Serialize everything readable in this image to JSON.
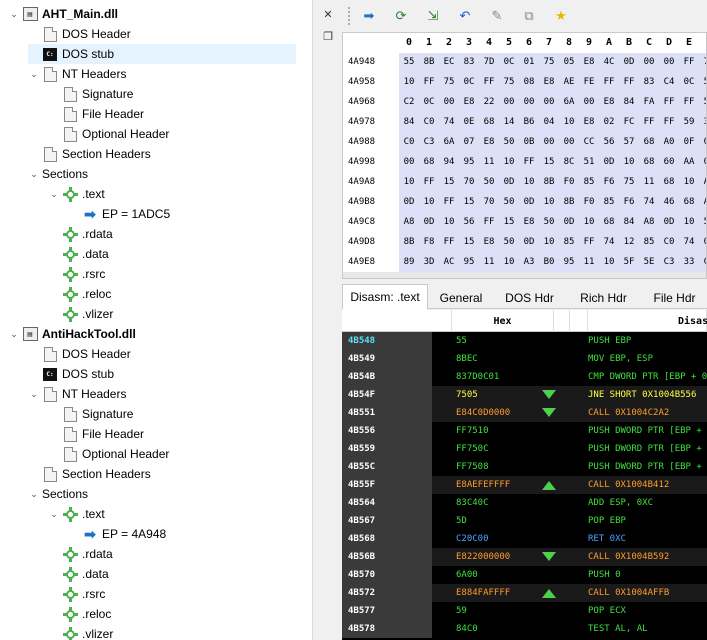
{
  "tree": [
    {
      "label": "AHT_Main.dll",
      "level": 0,
      "icon": "dll",
      "exp": "down",
      "bold": true
    },
    {
      "label": "DOS Header",
      "level": 1,
      "icon": "file"
    },
    {
      "label": "DOS stub",
      "level": 1,
      "icon": "dos",
      "selected": true
    },
    {
      "label": "NT Headers",
      "level": 1,
      "icon": "file",
      "exp": "down"
    },
    {
      "label": "Signature",
      "level": 2,
      "icon": "file"
    },
    {
      "label": "File Header",
      "level": 2,
      "icon": "file"
    },
    {
      "label": "Optional Header",
      "level": 2,
      "icon": "file"
    },
    {
      "label": "Section Headers",
      "level": 1,
      "icon": "file"
    },
    {
      "label": "Sections",
      "level": 1,
      "icon": "none",
      "exp": "down"
    },
    {
      "label": ".text",
      "level": 2,
      "icon": "gear",
      "exp": "down"
    },
    {
      "label": "EP = 1ADC5",
      "level": 3,
      "icon": "arrow"
    },
    {
      "label": ".rdata",
      "level": 2,
      "icon": "gear"
    },
    {
      "label": ".data",
      "level": 2,
      "icon": "gear"
    },
    {
      "label": ".rsrc",
      "level": 2,
      "icon": "gear"
    },
    {
      "label": ".reloc",
      "level": 2,
      "icon": "gear"
    },
    {
      "label": ".vlizer",
      "level": 2,
      "icon": "gear"
    },
    {
      "label": "AntiHackTool.dll",
      "level": 0,
      "icon": "dll",
      "exp": "down",
      "bold": true
    },
    {
      "label": "DOS Header",
      "level": 1,
      "icon": "file"
    },
    {
      "label": "DOS stub",
      "level": 1,
      "icon": "dos"
    },
    {
      "label": "NT Headers",
      "level": 1,
      "icon": "file",
      "exp": "down"
    },
    {
      "label": "Signature",
      "level": 2,
      "icon": "file"
    },
    {
      "label": "File Header",
      "level": 2,
      "icon": "file"
    },
    {
      "label": "Optional Header",
      "level": 2,
      "icon": "file"
    },
    {
      "label": "Section Headers",
      "level": 1,
      "icon": "file"
    },
    {
      "label": "Sections",
      "level": 1,
      "icon": "none",
      "exp": "down"
    },
    {
      "label": ".text",
      "level": 2,
      "icon": "gear",
      "exp": "down"
    },
    {
      "label": "EP = 4A948",
      "level": 3,
      "icon": "arrow"
    },
    {
      "label": ".rdata",
      "level": 2,
      "icon": "gear"
    },
    {
      "label": ".data",
      "level": 2,
      "icon": "gear"
    },
    {
      "label": ".rsrc",
      "level": 2,
      "icon": "gear"
    },
    {
      "label": ".reloc",
      "level": 2,
      "icon": "gear"
    },
    {
      "label": ".vlizer",
      "level": 2,
      "icon": "gear"
    }
  ],
  "splitter": {
    "close": "✕",
    "restore": "❐"
  },
  "toolbar": [
    {
      "name": "go-to-icon",
      "glyph": "➡",
      "color": "#1a73c8"
    },
    {
      "name": "refresh-icon",
      "glyph": "⟳",
      "color": "#2e7d32"
    },
    {
      "name": "import-icon",
      "glyph": "⇲",
      "color": "#2e7d32"
    },
    {
      "name": "undo-icon",
      "glyph": "↶",
      "color": "#1a56c8"
    },
    {
      "name": "pin-icon",
      "glyph": "✎",
      "color": "#888888"
    },
    {
      "name": "copy-icon",
      "glyph": "⧉",
      "color": "#888888"
    },
    {
      "name": "favorite-icon",
      "glyph": "★",
      "color": "#e6b800"
    }
  ],
  "hex": {
    "columns": [
      "0",
      "1",
      "2",
      "3",
      "4",
      "5",
      "6",
      "7",
      "8",
      "9",
      "A",
      "B",
      "C",
      "D",
      "E",
      "F"
    ],
    "rows": [
      {
        "addr": "4A948",
        "bytes": [
          "55",
          "8B",
          "EC",
          "83",
          "7D",
          "0C",
          "01",
          "75",
          "05",
          "E8",
          "4C",
          "0D",
          "00",
          "00",
          "FF",
          "75"
        ]
      },
      {
        "addr": "4A958",
        "bytes": [
          "10",
          "FF",
          "75",
          "0C",
          "FF",
          "75",
          "08",
          "E8",
          "AE",
          "FE",
          "FF",
          "FF",
          "83",
          "C4",
          "0C",
          "5D"
        ]
      },
      {
        "addr": "4A968",
        "bytes": [
          "C2",
          "0C",
          "00",
          "E8",
          "22",
          "00",
          "00",
          "00",
          "6A",
          "00",
          "E8",
          "84",
          "FA",
          "FF",
          "FF",
          "59"
        ]
      },
      {
        "addr": "4A978",
        "bytes": [
          "84",
          "C0",
          "74",
          "0E",
          "68",
          "14",
          "B6",
          "04",
          "10",
          "E8",
          "02",
          "FC",
          "FF",
          "FF",
          "59",
          "33"
        ]
      },
      {
        "addr": "4A988",
        "bytes": [
          "C0",
          "C3",
          "6A",
          "07",
          "E8",
          "50",
          "0B",
          "00",
          "00",
          "CC",
          "56",
          "57",
          "68",
          "A0",
          "0F",
          "00"
        ]
      },
      {
        "addr": "4A998",
        "bytes": [
          "00",
          "68",
          "94",
          "95",
          "11",
          "10",
          "FF",
          "15",
          "8C",
          "51",
          "0D",
          "10",
          "68",
          "60",
          "AA",
          "0D"
        ]
      },
      {
        "addr": "4A9A8",
        "bytes": [
          "10",
          "FF",
          "15",
          "70",
          "50",
          "0D",
          "10",
          "8B",
          "F0",
          "85",
          "F6",
          "75",
          "11",
          "68",
          "10",
          "AA"
        ]
      },
      {
        "addr": "4A9B8",
        "bytes": [
          "0D",
          "10",
          "FF",
          "15",
          "70",
          "50",
          "0D",
          "10",
          "8B",
          "F0",
          "85",
          "F6",
          "74",
          "46",
          "68",
          "A0"
        ]
      },
      {
        "addr": "4A9C8",
        "bytes": [
          "A8",
          "0D",
          "10",
          "56",
          "FF",
          "15",
          "E8",
          "50",
          "0D",
          "10",
          "68",
          "84",
          "A8",
          "0D",
          "10",
          "56"
        ]
      },
      {
        "addr": "4A9D8",
        "bytes": [
          "8B",
          "F8",
          "FF",
          "15",
          "E8",
          "50",
          "0D",
          "10",
          "85",
          "FF",
          "74",
          "12",
          "85",
          "C0",
          "74",
          "0E"
        ]
      },
      {
        "addr": "4A9E8",
        "bytes": [
          "89",
          "3D",
          "AC",
          "95",
          "11",
          "10",
          "A3",
          "B0",
          "95",
          "11",
          "10",
          "5F",
          "5E",
          "C3",
          "33",
          "C0"
        ]
      },
      {
        "addr": "4A9F8",
        "bytes": [
          "50",
          "50",
          "6A",
          "01",
          "50",
          "FF",
          "15",
          "D0",
          "50",
          "0D",
          "10",
          "A3",
          "90",
          "95",
          "11",
          "10"
        ]
      }
    ]
  },
  "tabs": [
    "Disasm: .text",
    "General",
    "DOS Hdr",
    "Rich Hdr",
    "File Hdr"
  ],
  "disasm": {
    "headers": [
      "",
      "Hex",
      "",
      "",
      "Disasm"
    ],
    "rows": [
      {
        "addr": "4B548",
        "hex": "55",
        "mnem": "PUSH EBP",
        "kind": "norm",
        "cur": true
      },
      {
        "addr": "4B549",
        "hex": "8BEC",
        "mnem": "MOV EBP, ESP",
        "kind": "norm"
      },
      {
        "addr": "4B54B",
        "hex": "837D0C01",
        "mnem": "CMP DWORD PTR [EBP + 0XC], 1",
        "kind": "norm"
      },
      {
        "addr": "4B54F",
        "hex": "7505",
        "mnem": "JNE SHORT 0X1004B556",
        "kind": "jmp",
        "jump": "down",
        "hl": true
      },
      {
        "addr": "4B551",
        "hex": "E84C0D0000",
        "mnem": "CALL 0X1004C2A2",
        "kind": "call",
        "jump": "down",
        "hl": true
      },
      {
        "addr": "4B556",
        "hex": "FF7510",
        "mnem": "PUSH DWORD PTR [EBP + 0X10]",
        "kind": "norm"
      },
      {
        "addr": "4B559",
        "hex": "FF750C",
        "mnem": "PUSH DWORD PTR [EBP + 0XC]",
        "kind": "norm"
      },
      {
        "addr": "4B55C",
        "hex": "FF7508",
        "mnem": "PUSH DWORD PTR [EBP + 8]",
        "kind": "norm"
      },
      {
        "addr": "4B55F",
        "hex": "E8AEFEFFFF",
        "mnem": "CALL 0X1004B412",
        "kind": "call",
        "jump": "up",
        "hl": true
      },
      {
        "addr": "4B564",
        "hex": "83C40C",
        "mnem": "ADD ESP, 0XC",
        "kind": "norm"
      },
      {
        "addr": "4B567",
        "hex": "5D",
        "mnem": "POP EBP",
        "kind": "norm"
      },
      {
        "addr": "4B568",
        "hex": "C20C00",
        "mnem": "RET 0XC",
        "kind": "ret"
      },
      {
        "addr": "4B56B",
        "hex": "E822000000",
        "mnem": "CALL 0X1004B592",
        "kind": "call",
        "jump": "down",
        "hl": true
      },
      {
        "addr": "4B570",
        "hex": "6A00",
        "mnem": "PUSH 0",
        "kind": "norm"
      },
      {
        "addr": "4B572",
        "hex": "E884FAFFFF",
        "mnem": "CALL 0X1004AFFB",
        "kind": "call",
        "jump": "up",
        "hl": true
      },
      {
        "addr": "4B577",
        "hex": "59",
        "mnem": "POP ECX",
        "kind": "norm"
      },
      {
        "addr": "4B578",
        "hex": "84C0",
        "mnem": "TEST AL, AL",
        "kind": "norm"
      }
    ]
  }
}
